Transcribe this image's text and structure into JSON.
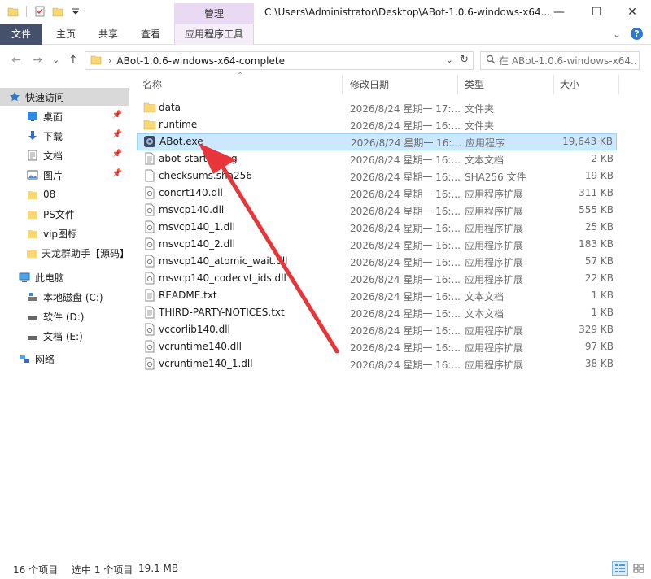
{
  "window": {
    "title": "C:\\Users\\Administrator\\Desktop\\ABot-1.0.6-windows-x64...",
    "manage_tab": "管理",
    "minimize": "—",
    "maximize": "☐",
    "close": "✕"
  },
  "ribbon": {
    "tabs": [
      "文件",
      "主页",
      "共享",
      "查看",
      "应用程序工具"
    ]
  },
  "nav": {
    "back": "←",
    "forward": "→",
    "recent": "⌄",
    "up": "↑",
    "path": "ABot-1.0.6-windows-x64-complete",
    "search_placeholder": "在 ABot-1.0.6-windows-x64..."
  },
  "sidebar": {
    "items": [
      {
        "label": "快速访问",
        "icon": "star-icon",
        "pinned": false,
        "selected": true
      },
      {
        "label": "桌面",
        "icon": "desktop-icon",
        "pinned": true
      },
      {
        "label": "下载",
        "icon": "download-icon",
        "pinned": true
      },
      {
        "label": "文档",
        "icon": "document-icon",
        "pinned": true
      },
      {
        "label": "图片",
        "icon": "picture-icon",
        "pinned": true
      },
      {
        "label": "08",
        "icon": "folder-icon",
        "pinned": false
      },
      {
        "label": "PS文件",
        "icon": "folder-icon",
        "pinned": false
      },
      {
        "label": "vip图标",
        "icon": "folder-icon",
        "pinned": false
      },
      {
        "label": "天龙群助手【源码】",
        "icon": "folder-icon",
        "pinned": false
      },
      {
        "label": "此电脑",
        "icon": "computer-icon",
        "pinned": false
      },
      {
        "label": "本地磁盘 (C:)",
        "icon": "drive-c-icon",
        "pinned": false
      },
      {
        "label": "软件 (D:)",
        "icon": "drive-icon",
        "pinned": false
      },
      {
        "label": "文档 (E:)",
        "icon": "drive-icon",
        "pinned": false
      },
      {
        "label": "网络",
        "icon": "network-icon",
        "pinned": false
      }
    ]
  },
  "columns": {
    "name": "名称",
    "date": "修改日期",
    "type": "类型",
    "size": "大小"
  },
  "files": [
    {
      "name": "data",
      "date": "2026/8/24 星期一 17:...",
      "type": "文件夹",
      "size": "",
      "icon": "folder-icon"
    },
    {
      "name": "runtime",
      "date": "2026/8/24 星期一 16:...",
      "type": "文件夹",
      "size": "",
      "icon": "folder-icon"
    },
    {
      "name": "ABot.exe",
      "date": "2026/8/24 星期一 16:...",
      "type": "应用程序",
      "size": "19,643 KB",
      "icon": "app-icon",
      "selected": true
    },
    {
      "name": "abot-startup.log",
      "date": "2026/8/24 星期一 16:...",
      "type": "文本文档",
      "size": "2 KB",
      "icon": "text-file-icon"
    },
    {
      "name": "checksums.sha256",
      "date": "2026/8/24 星期一 16:...",
      "type": "SHA256 文件",
      "size": "19 KB",
      "icon": "blank-file-icon"
    },
    {
      "name": "concrt140.dll",
      "date": "2026/8/24 星期一 16:...",
      "type": "应用程序扩展",
      "size": "311 KB",
      "icon": "dll-file-icon"
    },
    {
      "name": "msvcp140.dll",
      "date": "2026/8/24 星期一 16:...",
      "type": "应用程序扩展",
      "size": "555 KB",
      "icon": "dll-file-icon"
    },
    {
      "name": "msvcp140_1.dll",
      "date": "2026/8/24 星期一 16:...",
      "type": "应用程序扩展",
      "size": "25 KB",
      "icon": "dll-file-icon"
    },
    {
      "name": "msvcp140_2.dll",
      "date": "2026/8/24 星期一 16:...",
      "type": "应用程序扩展",
      "size": "183 KB",
      "icon": "dll-file-icon"
    },
    {
      "name": "msvcp140_atomic_wait.dll",
      "date": "2026/8/24 星期一 16:...",
      "type": "应用程序扩展",
      "size": "57 KB",
      "icon": "dll-file-icon"
    },
    {
      "name": "msvcp140_codecvt_ids.dll",
      "date": "2026/8/24 星期一 16:...",
      "type": "应用程序扩展",
      "size": "22 KB",
      "icon": "dll-file-icon"
    },
    {
      "name": "README.txt",
      "date": "2026/8/24 星期一 16:...",
      "type": "文本文档",
      "size": "1 KB",
      "icon": "text-file-icon"
    },
    {
      "name": "THIRD-PARTY-NOTICES.txt",
      "date": "2026/8/24 星期一 16:...",
      "type": "文本文档",
      "size": "1 KB",
      "icon": "text-file-icon"
    },
    {
      "name": "vccorlib140.dll",
      "date": "2026/8/24 星期一 16:...",
      "type": "应用程序扩展",
      "size": "329 KB",
      "icon": "dll-file-icon"
    },
    {
      "name": "vcruntime140.dll",
      "date": "2026/8/24 星期一 16:...",
      "type": "应用程序扩展",
      "size": "97 KB",
      "icon": "dll-file-icon"
    },
    {
      "name": "vcruntime140_1.dll",
      "date": "2026/8/24 星期一 16:...",
      "type": "应用程序扩展",
      "size": "38 KB",
      "icon": "dll-file-icon"
    }
  ],
  "status": {
    "count": "16 个项目",
    "selection": "选中 1 个项目",
    "selection_size": "19.1 MB"
  },
  "colors": {
    "selection_bg": "#cce8ff",
    "selection_border": "#99d1ff",
    "manage_tab": "#e9d9f3",
    "annotation_arrow": "#e8353a",
    "folder": "#f8d775"
  }
}
